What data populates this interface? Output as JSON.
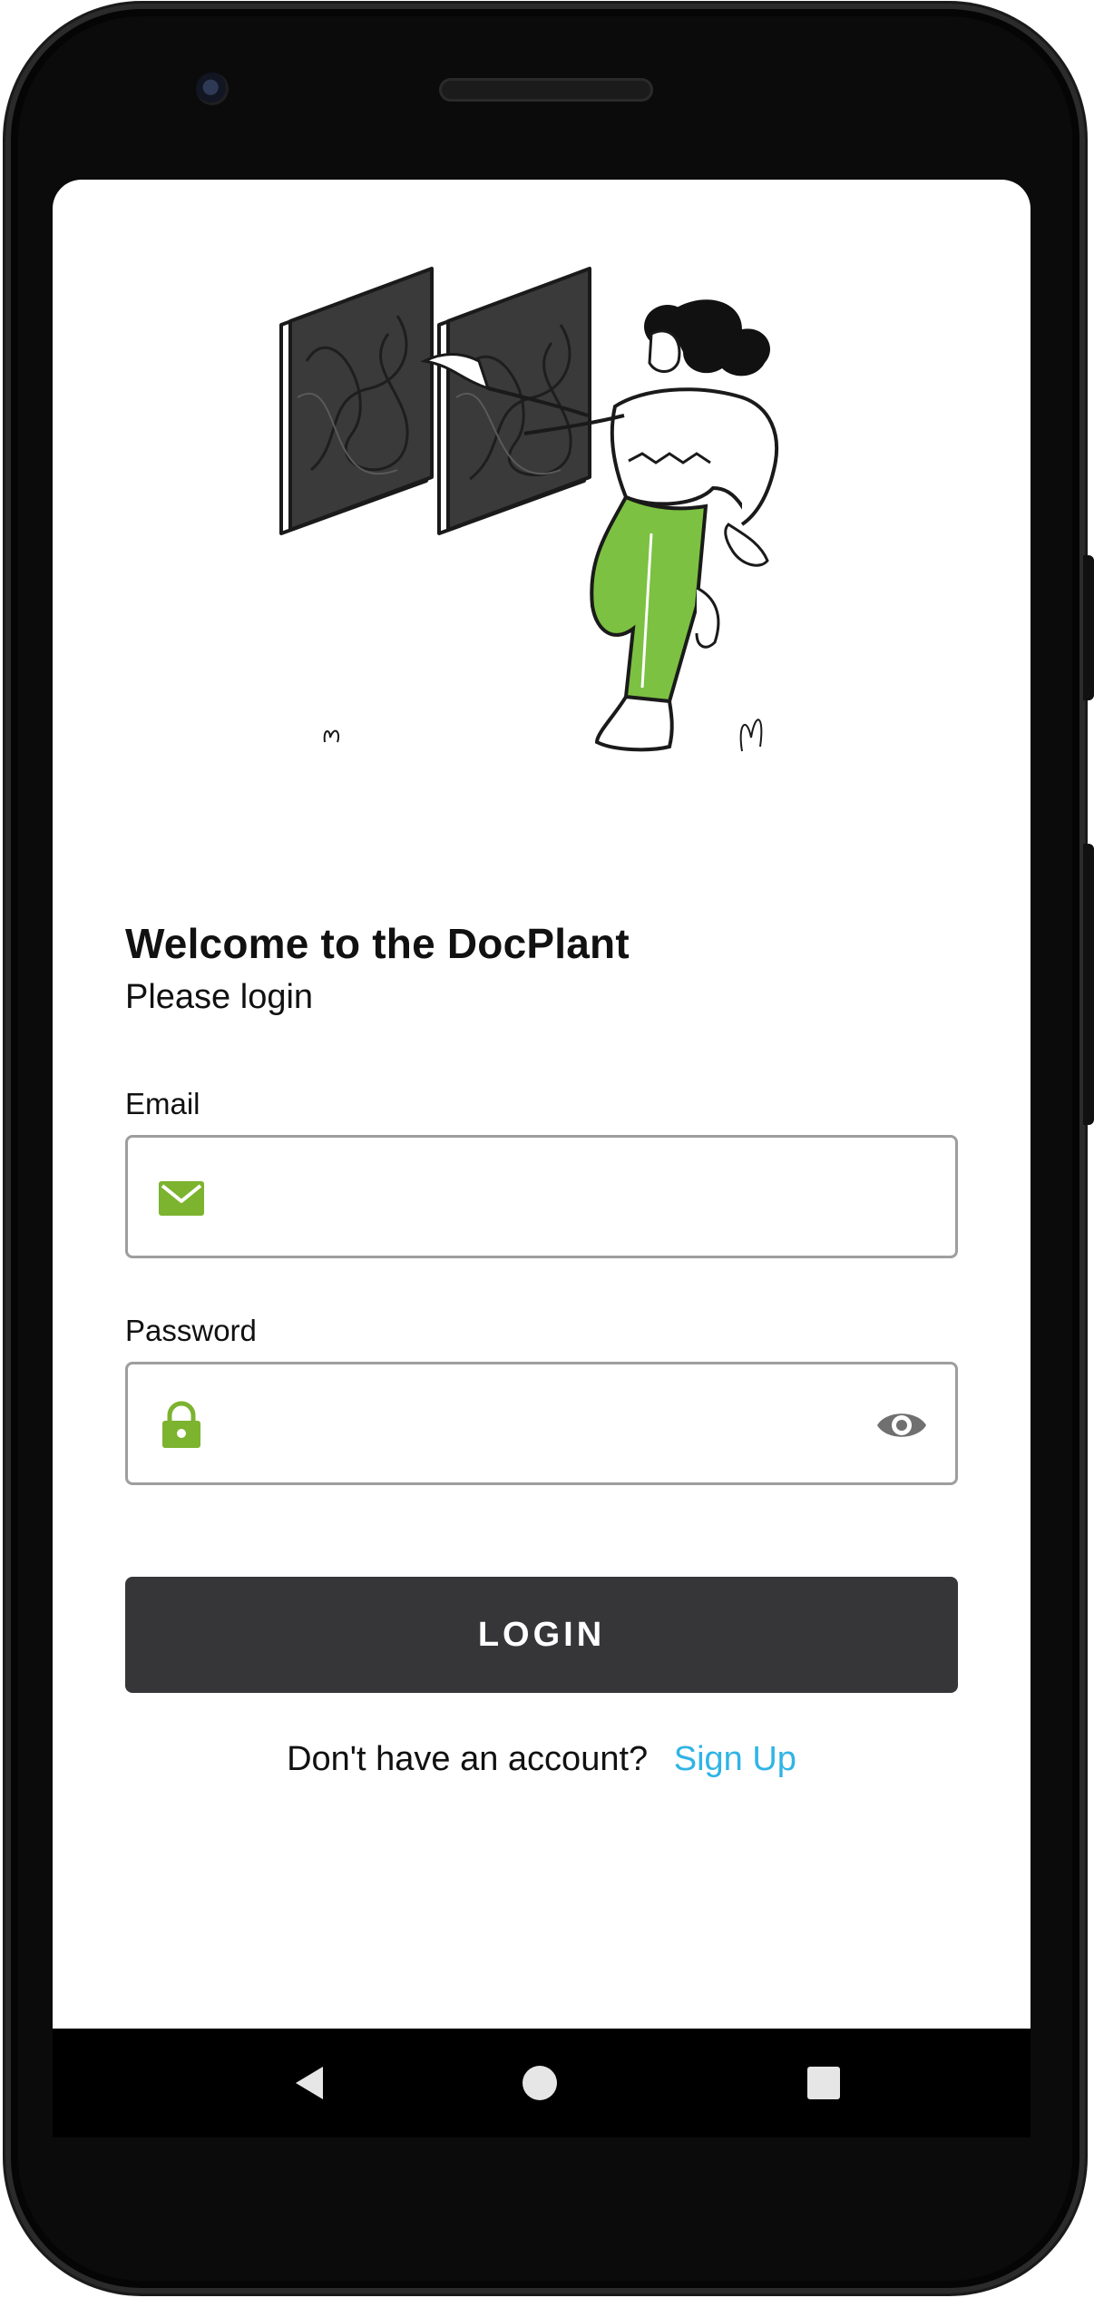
{
  "login": {
    "title": "Welcome to the DocPlant",
    "subtitle": "Please login",
    "email_label": "Email",
    "email_value": "",
    "password_label": "Password",
    "password_value": "",
    "login_button": "LOGIN",
    "signup_prompt": "Don't have an account?",
    "signup_link": "Sign Up"
  },
  "icons": {
    "email_icon": "envelope-icon",
    "password_icon": "lock-icon",
    "toggle_visibility_icon": "eye-icon",
    "nav_back": "triangle-back-icon",
    "nav_home": "circle-home-icon",
    "nav_recents": "square-recents-icon"
  },
  "colors": {
    "accent_green": "#7cb32f",
    "button_dark": "#363638",
    "link_blue": "#2fb4e6",
    "border_gray": "#9e9e9e"
  }
}
